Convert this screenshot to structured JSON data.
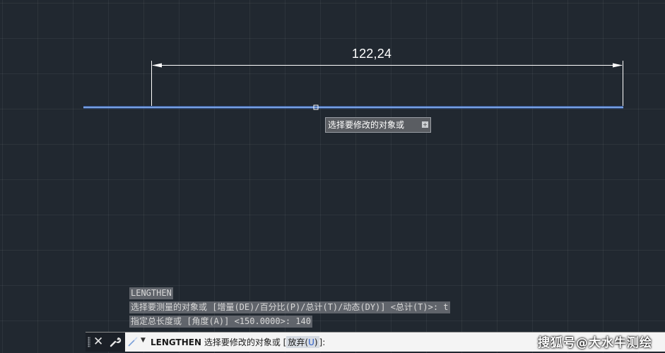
{
  "drawing": {
    "dimension_text": "122,24"
  },
  "tooltip": {
    "text": "选择要修改的对象或",
    "icon": "plus-icon"
  },
  "history": [
    "LENGTHEN",
    "选择要测量的对象或 [增量(DE)/百分比(P)/总计(T)/动态(DY)] <总计(T)>: t",
    "指定总长度或 [角度(A)] <150.0000>: 140"
  ],
  "command_line": {
    "close_icon": "close-icon",
    "settings_icon": "wrench-icon",
    "command_icon": "lengthen-icon",
    "dropdown_icon": "caret-down-icon",
    "command_name": "LENGTHEN",
    "prompt": "选择要修改的对象或",
    "bracket_open": "[",
    "option_label": "放弃",
    "option_key_open": "(",
    "option_key": "U",
    "option_key_close": ")",
    "bracket_close": "]:"
  },
  "watermark": "搜狐号@大水牛测绘",
  "colors": {
    "background": "#212830",
    "line": "#6fa6ff",
    "dimension": "#ffffff",
    "tooltip_bg": "#5a5d62",
    "command_bg": "#f4f4f4"
  }
}
